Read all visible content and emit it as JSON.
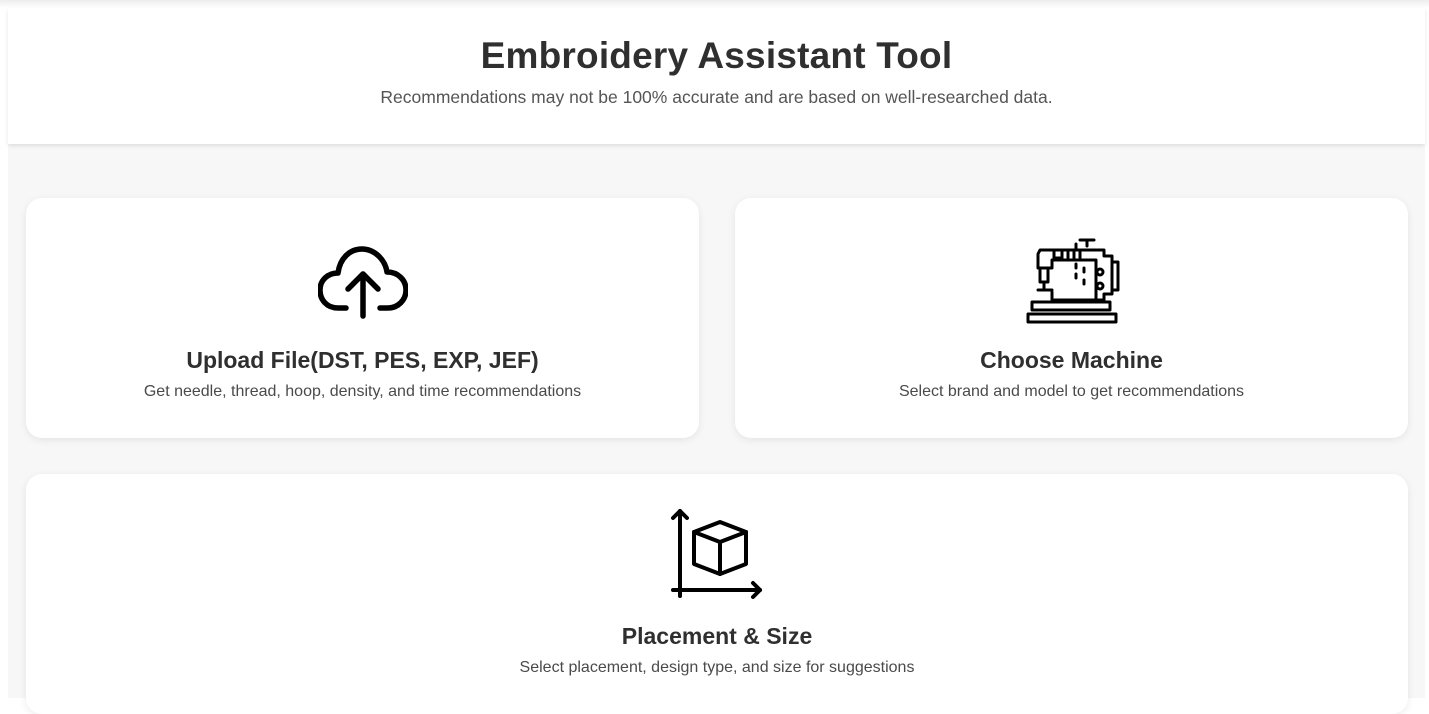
{
  "header": {
    "title": "Embroidery Assistant Tool",
    "subtitle": "Recommendations may not be 100% accurate and are based on well-researched data."
  },
  "cards": [
    {
      "title": "Upload File(DST, PES, EXP, JEF)",
      "description": "Get needle, thread, hoop, density, and time recommendations",
      "icon": "cloud-upload-icon"
    },
    {
      "title": "Choose Machine",
      "description": "Select brand and model to get recommendations",
      "icon": "sewing-machine-icon"
    },
    {
      "title": "Placement & Size",
      "description": "Select placement, design type, and size for suggestions",
      "icon": "box-axes-icon"
    }
  ],
  "colors": {
    "text_primary": "#2f2f2f",
    "text_secondary": "#555555",
    "background": "#f7f7f7",
    "card": "#ffffff"
  }
}
